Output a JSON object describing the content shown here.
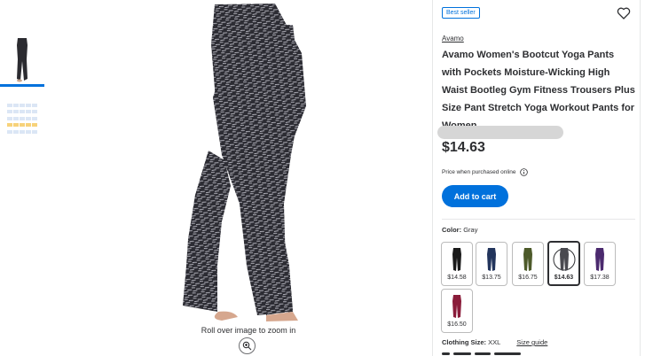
{
  "gallery": {
    "thumbnails": [
      {
        "icon": "pants-thumbnail",
        "active": true
      },
      {
        "icon": "size-chart-thumbnail",
        "active": false
      }
    ],
    "zoom_hint": "Roll over image to zoom in"
  },
  "product": {
    "badge": "Best seller",
    "brand": "Avamo",
    "title": "Avamo Women's Bootcut Yoga Pants with Pockets Moisture-Wicking High Waist Bootleg Gym Fitness Trousers Plus Size Pant Stretch Yoga Workout Pants for Women",
    "price": "$14.63",
    "price_note": "Price when purchased online",
    "add_to_cart": "Add to cart",
    "color_label": "Color:",
    "color_value": "Gray",
    "variants": [
      {
        "price": "$14.58",
        "color": "#1b1b1b",
        "selected": false
      },
      {
        "price": "$13.75",
        "color": "#22345c",
        "selected": false
      },
      {
        "price": "$16.75",
        "color": "#4d5a2a",
        "selected": false
      },
      {
        "price": "$14.63",
        "color": "#4a4a50",
        "selected": true
      },
      {
        "price": "$17.38",
        "color": "#4b2a6e",
        "selected": false
      },
      {
        "price": "$16.50",
        "color": "#8a1c3a",
        "selected": false
      }
    ],
    "size_label": "Clothing Size:",
    "size_value": "XXL",
    "size_guide": "Size guide"
  },
  "colors": {
    "accent": "#0071dc",
    "text": "#2e2f32",
    "border": "#e6e7e8"
  }
}
